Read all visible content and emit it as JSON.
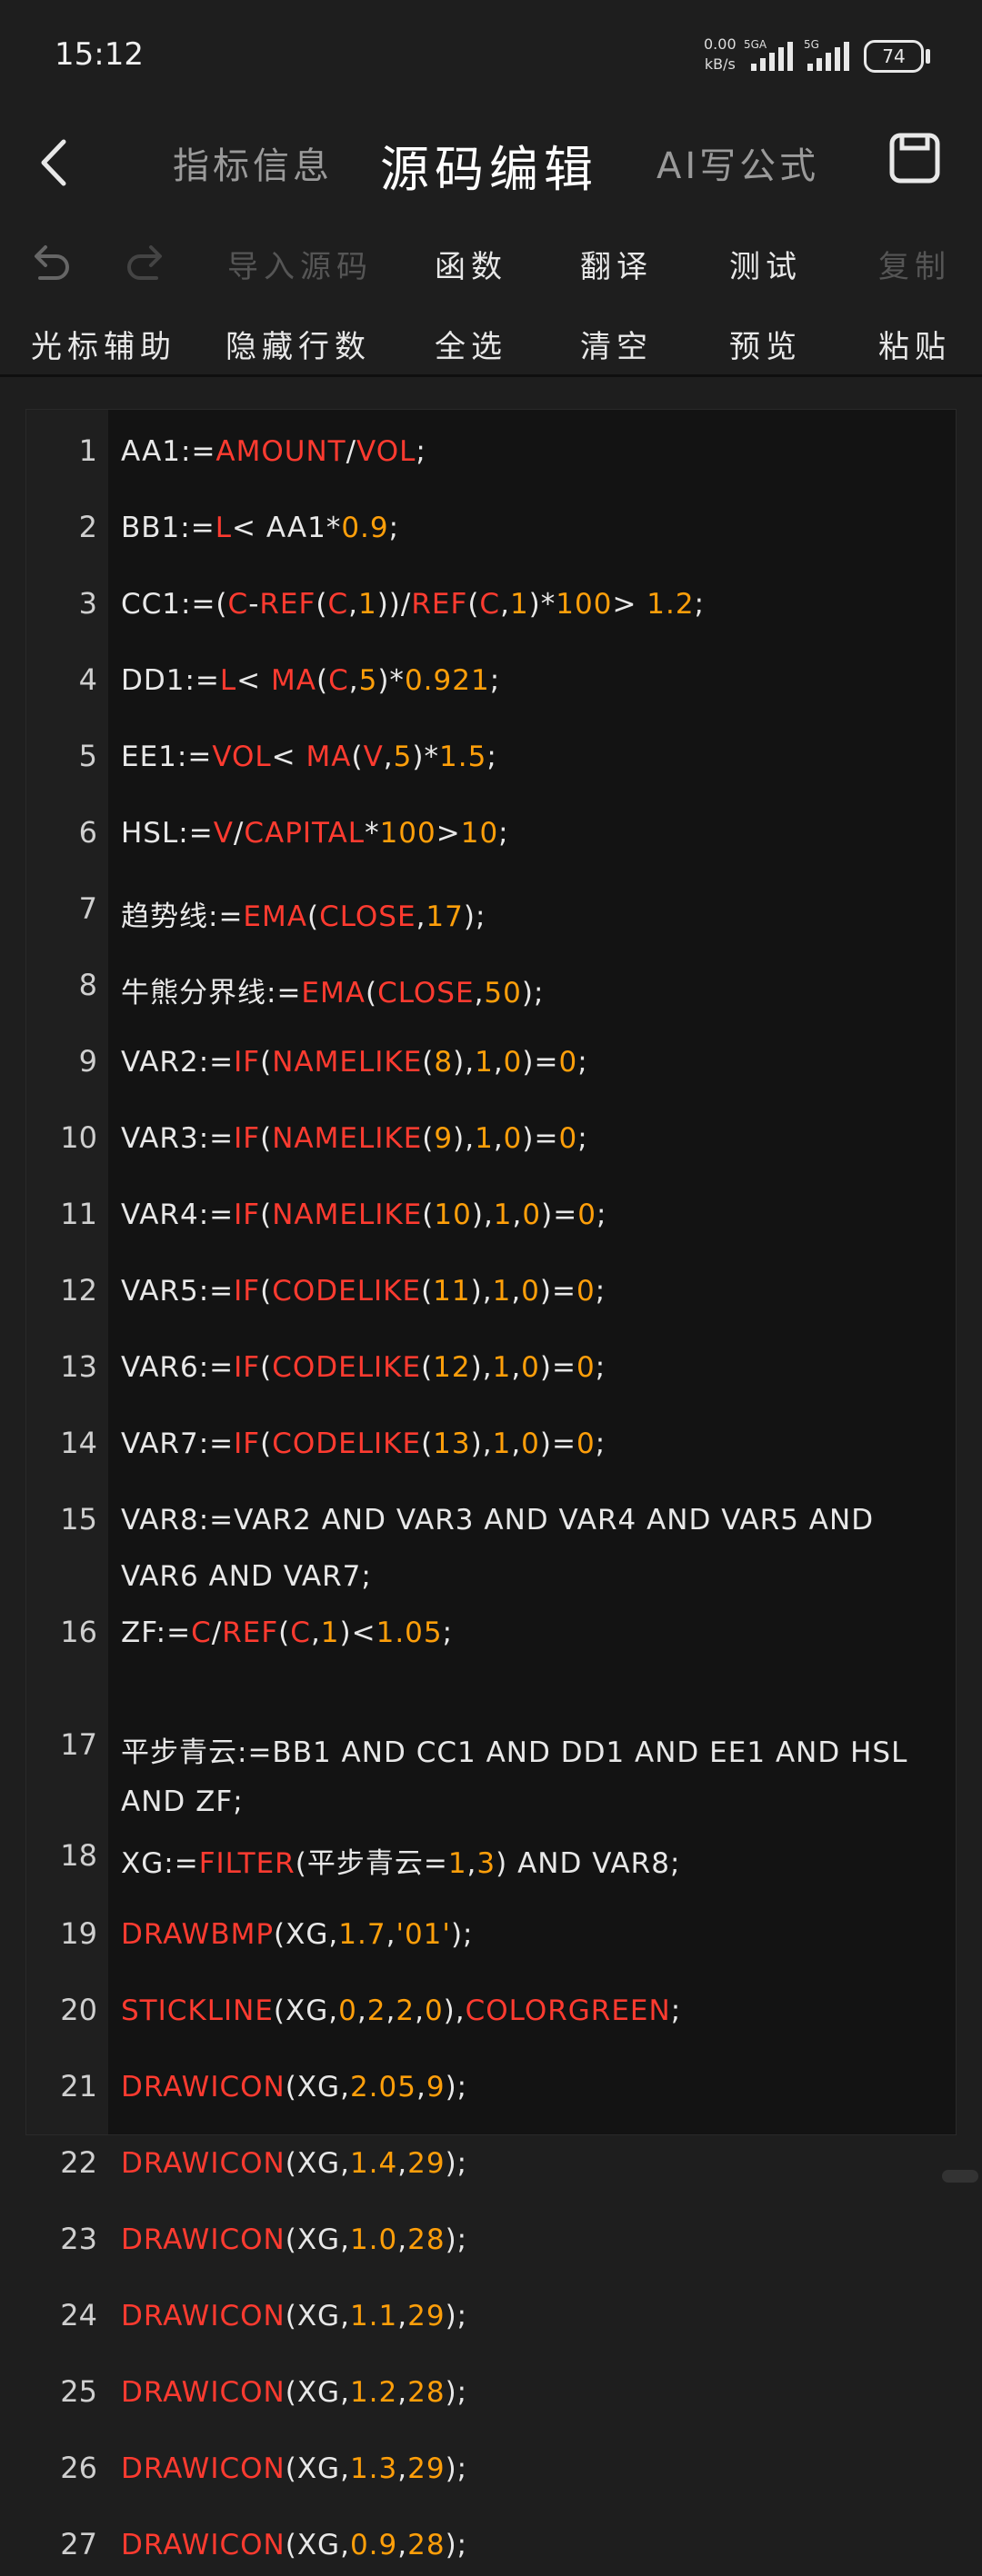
{
  "status_bar": {
    "time": "15:12",
    "net_speed_value": "0.00",
    "net_speed_unit": "kB/s",
    "net_type_1": "5GA",
    "net_type_2": "5G",
    "battery": "74"
  },
  "header": {
    "tabs": [
      {
        "label": "指标信息"
      },
      {
        "label": "源码编辑"
      },
      {
        "label": "AI写公式"
      }
    ]
  },
  "toolbar": {
    "row1": [
      "导入源码",
      "函数",
      "翻译",
      "测试",
      "复制"
    ],
    "row2": [
      "光标辅助",
      "隐藏行数",
      "全选",
      "清空",
      "预览",
      "粘贴"
    ]
  },
  "editor": {
    "lines": [
      {
        "num": "1",
        "text": "AA1:=AMOUNT/VOL;"
      },
      {
        "num": "2",
        "text": "BB1:=L< AA1*0.9;"
      },
      {
        "num": "3",
        "text": "CC1:=(C-REF(C,1))/REF(C,1)*100> 1.2;"
      },
      {
        "num": "4",
        "text": "DD1:=L< MA(C,5)*0.921;"
      },
      {
        "num": "5",
        "text": "EE1:=VOL< MA(V,5)*1.5;"
      },
      {
        "num": "6",
        "text": "HSL:=V/CAPITAL*100>10;"
      },
      {
        "num": "7",
        "text": "趋势线:=EMA(CLOSE,17);"
      },
      {
        "num": "8",
        "text": "牛熊分界线:=EMA(CLOSE,50);"
      },
      {
        "num": "9",
        "text": "VAR2:=IF(NAMELIKE(8),1,0)=0;"
      },
      {
        "num": "10",
        "text": "VAR3:=IF(NAMELIKE(9),1,0)=0;"
      },
      {
        "num": "11",
        "text": "VAR4:=IF(NAMELIKE(10),1,0)=0;"
      },
      {
        "num": "12",
        "text": "VAR5:=IF(CODELIKE(11),1,0)=0;"
      },
      {
        "num": "13",
        "text": "VAR6:=IF(CODELIKE(12),1,0)=0;"
      },
      {
        "num": "14",
        "text": "VAR7:=IF(CODELIKE(13),1,0)=0;"
      },
      {
        "num": "15",
        "text": "VAR8:=VAR2 AND VAR3 AND VAR4 AND VAR5 AND",
        "cont": "VAR6 AND VAR7;"
      },
      {
        "num": "16",
        "text": "ZF:=C/REF(C,1)<1.05;"
      },
      {
        "num": "17",
        "text": "平步青云:=BB1 AND CC1 AND DD1 AND EE1 AND HSL",
        "cont": "AND ZF;"
      },
      {
        "num": "18",
        "text": "XG:=FILTER(平步青云=1,3) AND VAR8;"
      },
      {
        "num": "19",
        "text": "DRAWBMP(XG,1.7,'01');"
      },
      {
        "num": "20",
        "text": "STICKLINE(XG,0,2,2,0),COLORGREEN;"
      },
      {
        "num": "21",
        "text": "DRAWICON(XG,2.05,9);"
      },
      {
        "num": "22",
        "text": "DRAWICON(XG,1.4,29);"
      },
      {
        "num": "23",
        "text": "DRAWICON(XG,1.0,28);"
      },
      {
        "num": "24",
        "text": "DRAWICON(XG,1.1,29);"
      },
      {
        "num": "25",
        "text": "DRAWICON(XG,1.2,28);"
      },
      {
        "num": "26",
        "text": "DRAWICON(XG,1.3,29);"
      },
      {
        "num": "27",
        "text": "DRAWICON(XG,0.9,28);"
      }
    ]
  },
  "colors": {
    "background": "#1e1e1e",
    "editor_bg": "#131313",
    "gutter_bg": "#1f1f1f",
    "keyword": "#ff3b30",
    "number": "#ff9f0a",
    "text": "#e8e8e8"
  }
}
